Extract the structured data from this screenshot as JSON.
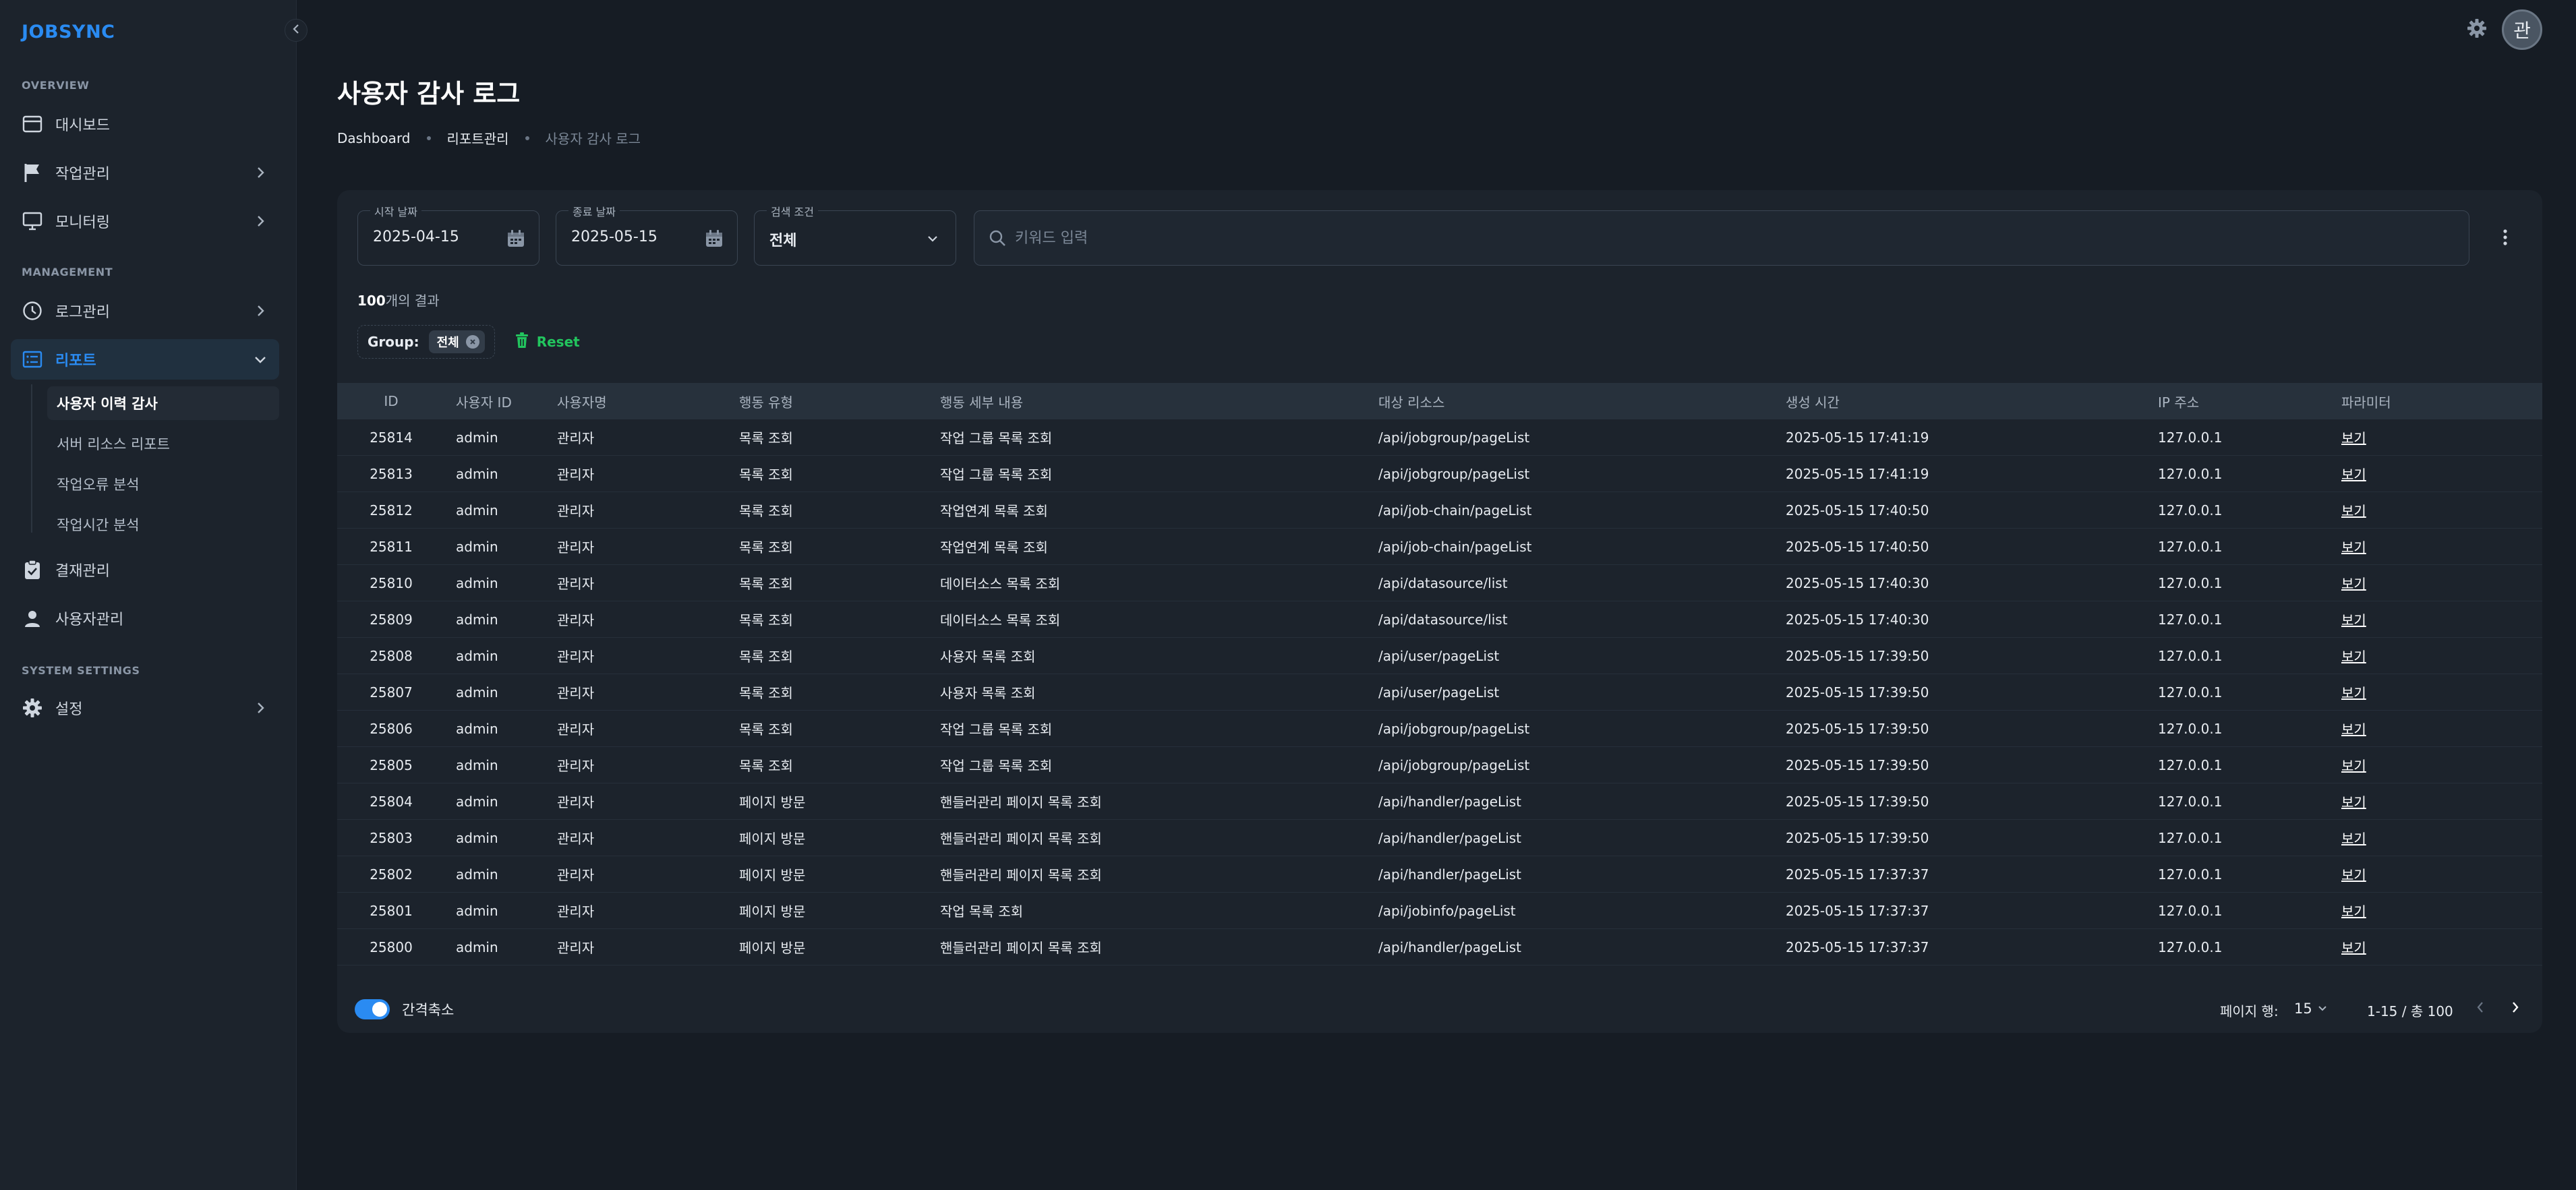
{
  "app": {
    "brand": "JOBSYNC"
  },
  "sidebar": {
    "sections": [
      "OVERVIEW",
      "MANAGEMENT",
      "SYSTEM SETTINGS"
    ],
    "items": [
      {
        "label": "대시보드",
        "icon": "dashboard-icon"
      },
      {
        "label": "작업관리",
        "icon": "flag-icon"
      },
      {
        "label": "모니터링",
        "icon": "monitor-icon"
      },
      {
        "label": "로그관리",
        "icon": "clock-icon"
      },
      {
        "label": "리포트",
        "icon": "report-icon",
        "active": true
      },
      {
        "label": "결재관리",
        "icon": "clipboard-icon"
      },
      {
        "label": "사용자관리",
        "icon": "user-icon"
      },
      {
        "label": "설정",
        "icon": "gear-icon"
      }
    ],
    "report_subitems": [
      {
        "label": "사용자 이력 감사",
        "active": true
      },
      {
        "label": "서버 리소스 리포트"
      },
      {
        "label": "작업오류 분석"
      },
      {
        "label": "작업시간 분석"
      }
    ]
  },
  "header": {
    "avatar_text": "관",
    "title": "사용자 감사 로그",
    "breadcrumb": [
      "Dashboard",
      "리포트관리",
      "사용자 감사 로그"
    ]
  },
  "filters": {
    "start_date": {
      "label": "시작 날짜",
      "value": "2025-04-15"
    },
    "end_date": {
      "label": "종료 날짜",
      "value": "2025-05-15"
    },
    "condition": {
      "label": "검색 조건",
      "value": "전체"
    },
    "search": {
      "placeholder": "키워드 입력"
    }
  },
  "results": {
    "count": "100",
    "suffix": "개의 결과"
  },
  "active_filter": {
    "group_label": "Group:",
    "chip": "전체",
    "reset_label": "Reset"
  },
  "table": {
    "columns": [
      "ID",
      "사용자 ID",
      "사용자명",
      "행동 유형",
      "행동 세부 내용",
      "대상 리소스",
      "생성 시간",
      "IP 주소",
      "파라미터"
    ],
    "rows": [
      [
        "25814",
        "admin",
        "관리자",
        "목록 조회",
        "작업 그룹 목록 조회",
        "/api/jobgroup/pageList",
        "2025-05-15 17:41:19",
        "127.0.0.1",
        "보기"
      ],
      [
        "25813",
        "admin",
        "관리자",
        "목록 조회",
        "작업 그룹 목록 조회",
        "/api/jobgroup/pageList",
        "2025-05-15 17:41:19",
        "127.0.0.1",
        "보기"
      ],
      [
        "25812",
        "admin",
        "관리자",
        "목록 조회",
        "작업연계 목록 조회",
        "/api/job-chain/pageList",
        "2025-05-15 17:40:50",
        "127.0.0.1",
        "보기"
      ],
      [
        "25811",
        "admin",
        "관리자",
        "목록 조회",
        "작업연계 목록 조회",
        "/api/job-chain/pageList",
        "2025-05-15 17:40:50",
        "127.0.0.1",
        "보기"
      ],
      [
        "25810",
        "admin",
        "관리자",
        "목록 조회",
        "데이터소스 목록 조회",
        "/api/datasource/list",
        "2025-05-15 17:40:30",
        "127.0.0.1",
        "보기"
      ],
      [
        "25809",
        "admin",
        "관리자",
        "목록 조회",
        "데이터소스 목록 조회",
        "/api/datasource/list",
        "2025-05-15 17:40:30",
        "127.0.0.1",
        "보기"
      ],
      [
        "25808",
        "admin",
        "관리자",
        "목록 조회",
        "사용자 목록 조회",
        "/api/user/pageList",
        "2025-05-15 17:39:50",
        "127.0.0.1",
        "보기"
      ],
      [
        "25807",
        "admin",
        "관리자",
        "목록 조회",
        "사용자 목록 조회",
        "/api/user/pageList",
        "2025-05-15 17:39:50",
        "127.0.0.1",
        "보기"
      ],
      [
        "25806",
        "admin",
        "관리자",
        "목록 조회",
        "작업 그룹 목록 조회",
        "/api/jobgroup/pageList",
        "2025-05-15 17:39:50",
        "127.0.0.1",
        "보기"
      ],
      [
        "25805",
        "admin",
        "관리자",
        "목록 조회",
        "작업 그룹 목록 조회",
        "/api/jobgroup/pageList",
        "2025-05-15 17:39:50",
        "127.0.0.1",
        "보기"
      ],
      [
        "25804",
        "admin",
        "관리자",
        "페이지 방문",
        "핸들러관리 페이지 목록 조회",
        "/api/handler/pageList",
        "2025-05-15 17:39:50",
        "127.0.0.1",
        "보기"
      ],
      [
        "25803",
        "admin",
        "관리자",
        "페이지 방문",
        "핸들러관리 페이지 목록 조회",
        "/api/handler/pageList",
        "2025-05-15 17:39:50",
        "127.0.0.1",
        "보기"
      ],
      [
        "25802",
        "admin",
        "관리자",
        "페이지 방문",
        "핸들러관리 페이지 목록 조회",
        "/api/handler/pageList",
        "2025-05-15 17:37:37",
        "127.0.0.1",
        "보기"
      ],
      [
        "25801",
        "admin",
        "관리자",
        "페이지 방문",
        "작업 목록 조회",
        "/api/jobinfo/pageList",
        "2025-05-15 17:37:37",
        "127.0.0.1",
        "보기"
      ],
      [
        "25800",
        "admin",
        "관리자",
        "페이지 방문",
        "핸들러관리 페이지 목록 조회",
        "/api/handler/pageList",
        "2025-05-15 17:37:37",
        "127.0.0.1",
        "보기"
      ]
    ]
  },
  "footer": {
    "dense_label": "간격축소",
    "dense_on": true,
    "rows_per_page_label": "페이지 행:",
    "rows_per_page": "15",
    "range": "1-15 / 총 100"
  },
  "colors": {
    "accent": "#2a8bf2",
    "reset": "#22c55e",
    "background": "#161c24",
    "card": "#1c232c"
  }
}
